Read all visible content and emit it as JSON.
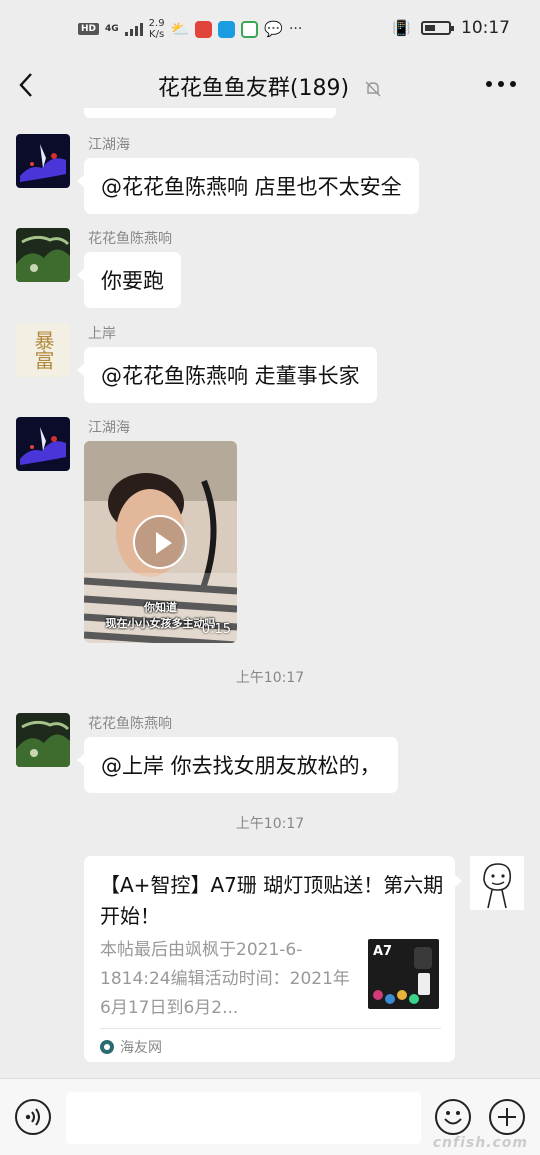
{
  "status_bar": {
    "network_badge": "HD",
    "network_type": "4G",
    "speed_value": "2.9",
    "speed_unit": "K/s",
    "more_dots": "···",
    "time": "10:17"
  },
  "header": {
    "title": "花花鱼鱼友群(189)",
    "back_icon": "chevron-left-icon",
    "mute_icon": "bell-muted-icon",
    "more_icon": "more-dots-icon"
  },
  "messages": [
    {
      "sender": "江湖海",
      "text": "@花花鱼陈燕响  店里也不太安全"
    },
    {
      "sender": "花花鱼陈燕响",
      "text": "你要跑"
    },
    {
      "sender": "上岸",
      "avatar_text": "暴富",
      "text": "@花花鱼陈燕响  走董事长家"
    },
    {
      "sender": "江湖海",
      "video": {
        "caption_line1": "你知道",
        "caption_line2": "现在小小女孩多主动吗",
        "duration": "0:15"
      }
    },
    {
      "timestamp": "上午10:17"
    },
    {
      "sender": "花花鱼陈燕响",
      "text": "@上岸  你去找女朋友放松的，"
    },
    {
      "timestamp": "上午10:17"
    },
    {
      "self": true,
      "card": {
        "title": "【A+智控】A7珊 瑚灯顶贴送！第六期开始！",
        "description": "本帖最后由飒枫于2021-6-1814:24编辑活动时间：2021年6月17日到6月2...",
        "thumb_label": "A7",
        "source": "海友网"
      }
    }
  ],
  "input_bar": {
    "voice_icon": "voice-icon",
    "emoji_icon": "emoji-icon",
    "plus_icon": "plus-icon",
    "watermark": "cnfish.com"
  },
  "colors": {
    "background": "#ededed",
    "bubble": "#ffffff",
    "meta_text": "#888888"
  }
}
